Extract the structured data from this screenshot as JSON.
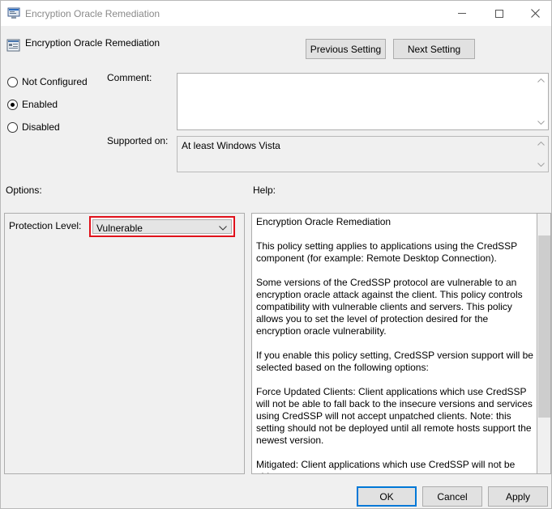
{
  "window": {
    "title": "Encryption Oracle Remediation"
  },
  "header": {
    "policy_name": "Encryption Oracle Remediation",
    "prev_label": "Previous Setting",
    "next_label": "Next Setting"
  },
  "state": {
    "options": [
      "Not Configured",
      "Enabled",
      "Disabled"
    ],
    "selected": "Enabled"
  },
  "comment": {
    "label": "Comment:",
    "value": ""
  },
  "supported": {
    "label": "Supported on:",
    "value": "At least Windows Vista"
  },
  "sections": {
    "options_label": "Options:",
    "help_label": "Help:"
  },
  "options": {
    "protection_label": "Protection Level:",
    "protection_value": "Vulnerable"
  },
  "help": {
    "paragraphs": [
      "Encryption Oracle Remediation",
      "This policy setting applies to applications using the CredSSP component (for example: Remote Desktop Connection).",
      "Some versions of the CredSSP protocol are vulnerable to an encryption oracle attack against the client.  This policy controls compatibility with vulnerable clients and servers.  This policy allows you to set the level of protection desired for the encryption oracle vulnerability.",
      "If you enable this policy setting, CredSSP version support will be selected based on the following options:",
      "Force Updated Clients: Client applications which use CredSSP will not be able to fall back to the insecure versions and services using CredSSP will not accept unpatched clients. Note: this setting should not be deployed until all remote hosts support the newest version.",
      "Mitigated: Client applications which use CredSSP will not be able"
    ]
  },
  "footer": {
    "ok_label": "OK",
    "cancel_label": "Cancel",
    "apply_label": "Apply"
  },
  "colors": {
    "highlight_border": "#e0101a",
    "ok_border": "#0078d7"
  }
}
